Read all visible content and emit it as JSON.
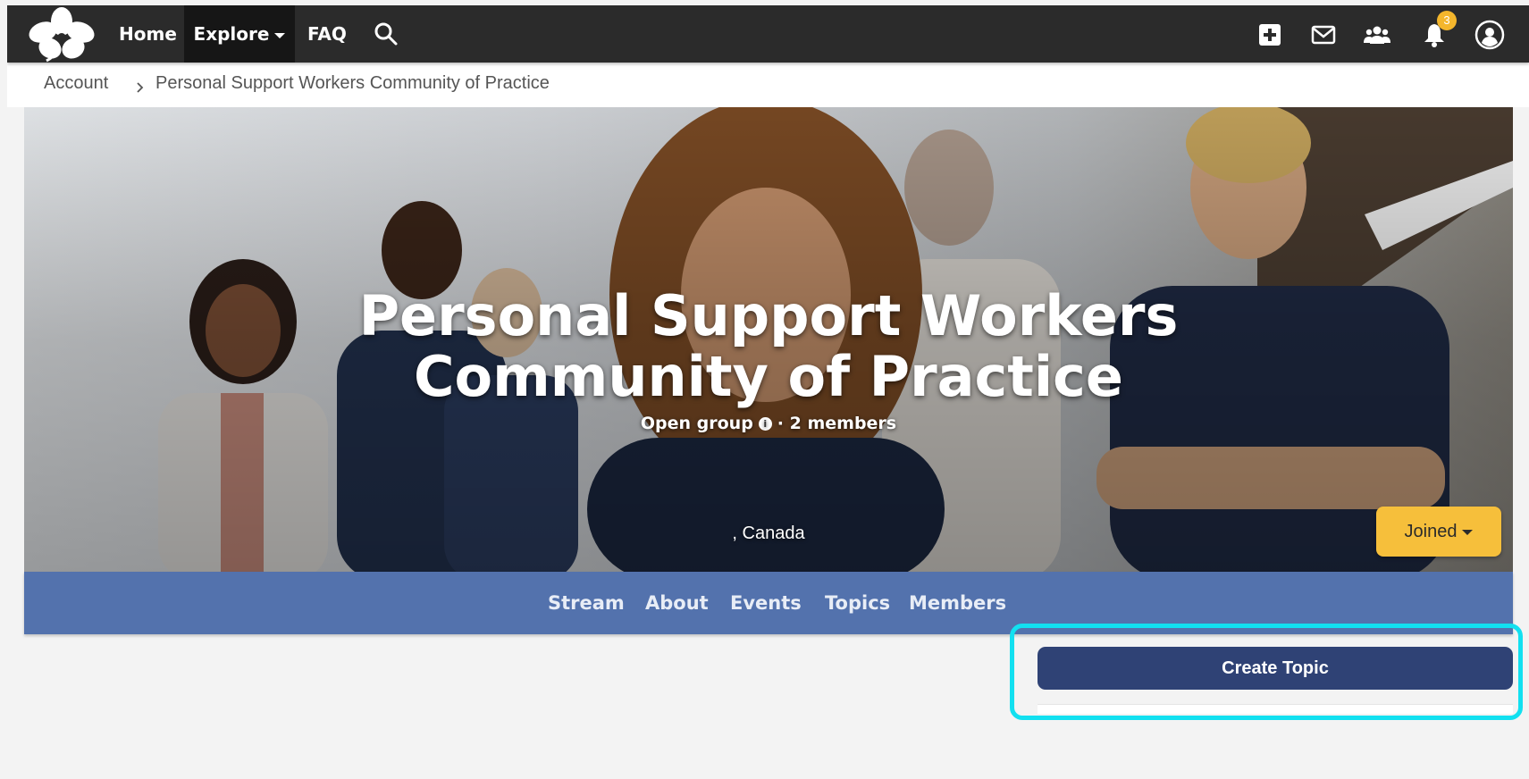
{
  "topbar": {
    "nav": {
      "home": "Home",
      "explore": "Explore",
      "faq": "FAQ"
    },
    "notification_count": "3",
    "icons": [
      "logo-flower-icon",
      "search-icon",
      "add-content-icon",
      "mail-icon",
      "people-icon",
      "bell-icon",
      "avatar-icon"
    ]
  },
  "breadcrumb": {
    "account": "Account",
    "current": "Personal Support Workers Community of Practice"
  },
  "hero": {
    "title_line1": "Personal Support Workers",
    "title_line2": "Community of Practice",
    "group_type": "Open group",
    "members": "· 2 members",
    "location": ", Canada",
    "joined_label": "Joined"
  },
  "tabs": {
    "stream": "Stream",
    "about": "About",
    "events": "Events",
    "topics": "Topics",
    "members": "Members"
  },
  "actions": {
    "create_topic": "Create Topic"
  },
  "colors": {
    "topbar": "#2b2b2b",
    "tab_bar": "#5372ad",
    "joined_button": "#f6bf3b",
    "create_button": "#2f4275",
    "highlight": "#12e0f0",
    "badge": "#f4b62c"
  }
}
